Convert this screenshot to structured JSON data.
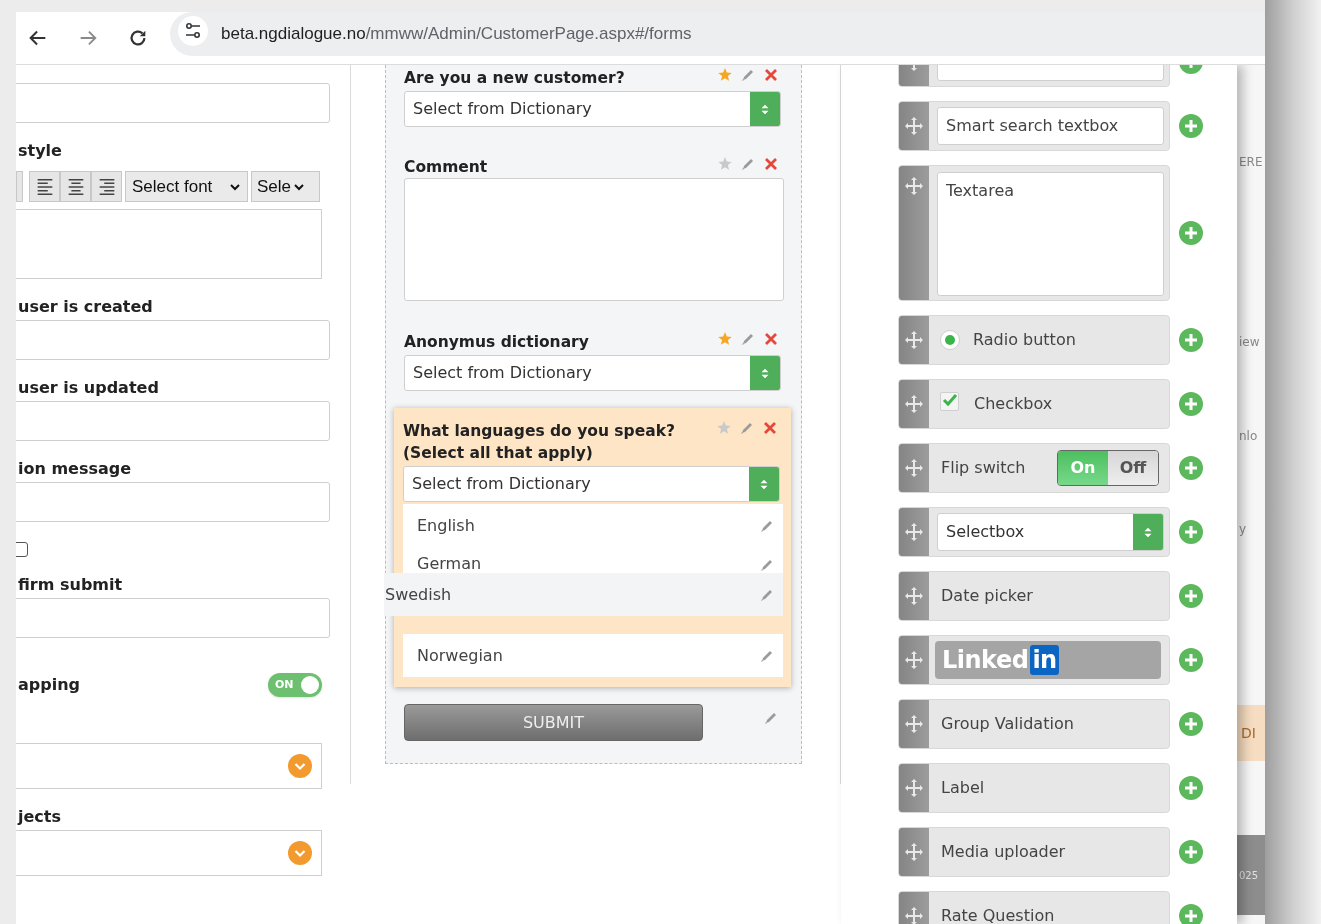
{
  "browser": {
    "url_host": "beta.ngdialogue.no",
    "url_path": "/mmww/Admin/CustomerPage.aspx#/forms"
  },
  "settings": {
    "items": [
      {
        "kind": "field"
      },
      {
        "kind": "label",
        "text": "style"
      },
      {
        "kind": "toolbar",
        "font_select": "Select font",
        "size_select": "Sele"
      },
      {
        "kind": "textarea"
      },
      {
        "kind": "label",
        "text": "user is created"
      },
      {
        "kind": "field"
      },
      {
        "kind": "label",
        "text": "user is updated"
      },
      {
        "kind": "field"
      },
      {
        "kind": "label",
        "text": "ion message"
      },
      {
        "kind": "field"
      },
      {
        "kind": "checkbox",
        "checked": false
      },
      {
        "kind": "label",
        "text": "firm submit"
      },
      {
        "kind": "field"
      },
      {
        "kind": "toggle",
        "text": "apping",
        "on": true,
        "on_text": "ON"
      },
      {
        "kind": "dropdown"
      },
      {
        "kind": "label",
        "text": "jects"
      },
      {
        "kind": "dropdown"
      }
    ]
  },
  "form": {
    "fields": [
      {
        "kind": "select",
        "label": "Are you a new customer?",
        "required": true,
        "highlighted": false,
        "placeholder": "Select from Dictionary"
      },
      {
        "kind": "textarea",
        "label": "Comment",
        "required": false,
        "highlighted": false
      },
      {
        "kind": "select",
        "label": "Anonymus dictionary",
        "required": true,
        "highlighted": false,
        "placeholder": "Select from Dictionary"
      },
      {
        "kind": "multiselect",
        "label": "What languages do you speak? (Select all that apply)",
        "required": false,
        "highlighted": true,
        "placeholder": "Select from Dictionary",
        "options": [
          {
            "kind": "item",
            "label": "English"
          },
          {
            "kind": "partial",
            "label": "German"
          },
          {
            "kind": "dragged",
            "label": "Swedish"
          },
          {
            "kind": "drop-slot"
          },
          {
            "kind": "item",
            "label": "Norwegian"
          }
        ]
      }
    ],
    "submit": "SUBMIT"
  },
  "palette": {
    "items": [
      {
        "kind": "textbox"
      },
      {
        "kind": "textbox",
        "label": "Smart search textbox"
      },
      {
        "kind": "textarea",
        "label": "Textarea"
      },
      {
        "kind": "radio",
        "label": "Radio button",
        "checked": true
      },
      {
        "kind": "checkbox",
        "label": "Checkbox",
        "checked": true
      },
      {
        "kind": "flip",
        "label": "Flip switch",
        "on": true,
        "on_text": "On",
        "off_text": "Off"
      },
      {
        "kind": "select",
        "label": "Selectbox"
      },
      {
        "kind": "plain",
        "label": "Date picker"
      },
      {
        "kind": "logo",
        "label": "Linked",
        "badge": "in"
      },
      {
        "kind": "plain",
        "label": "Group Validation"
      },
      {
        "kind": "plain",
        "label": "Label"
      },
      {
        "kind": "plain",
        "label": "Media uploader"
      },
      {
        "kind": "plain",
        "label": "Rate Question"
      }
    ]
  },
  "background_page": {
    "fragments": [
      {
        "kind": "text",
        "text": "ERE"
      },
      {
        "kind": "text",
        "text": "iew"
      },
      {
        "kind": "text",
        "text": "nlo"
      },
      {
        "kind": "text",
        "text": "y"
      },
      {
        "kind": "peach",
        "text": "DI"
      },
      {
        "kind": "dark",
        "text": "025"
      }
    ]
  }
}
